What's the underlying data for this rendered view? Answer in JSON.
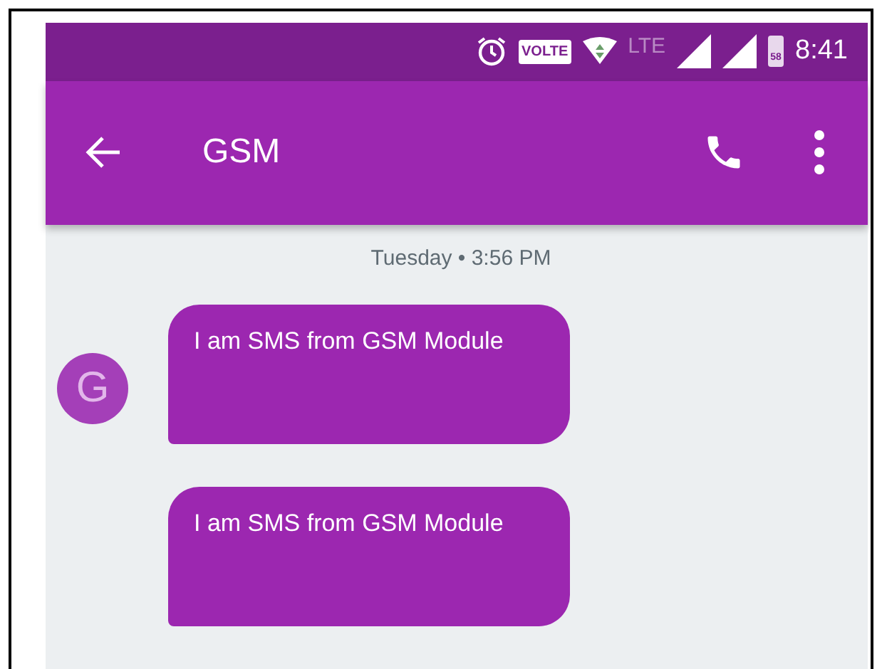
{
  "status_bar": {
    "volte": "VOLTE",
    "network": "LTE",
    "battery": "58",
    "time": "8:41"
  },
  "app_bar": {
    "title": "GSM"
  },
  "conversation": {
    "timestamp": "Tuesday • 3:56 PM",
    "messages": [
      {
        "text": "I am SMS from GSM Module",
        "avatar": "G"
      },
      {
        "text": "I am SMS from GSM Module"
      }
    ]
  }
}
